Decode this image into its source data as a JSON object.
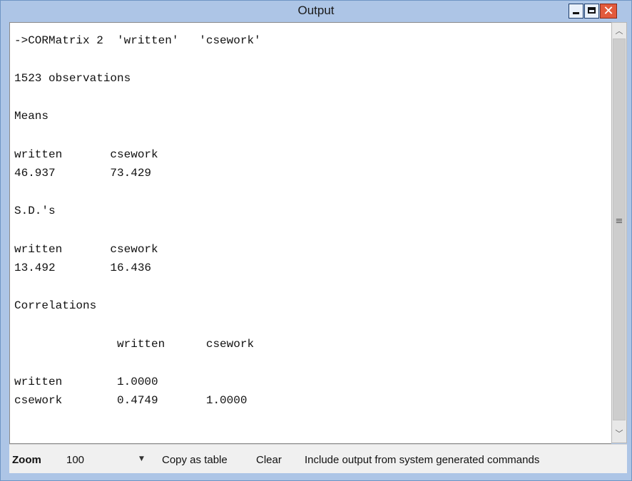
{
  "window": {
    "title": "Output",
    "minimize_glyph": "",
    "maximize_glyph": "",
    "close_glyph": "✕"
  },
  "output": {
    "lines": [
      "->CORMatrix 2  'written'   'csework'",
      "",
      "1523 observations",
      "",
      "Means",
      "",
      "written       csework",
      "46.937        73.429",
      "",
      "S.D.'s",
      "",
      "written       csework",
      "13.492        16.436",
      "",
      "Correlations",
      "",
      "               written      csework",
      "",
      "written        1.0000",
      "csework        0.4749       1.0000"
    ]
  },
  "scrollbar": {
    "up_icon": "chevron-up-icon",
    "down_icon": "chevron-down-icon",
    "up_glyph": "︿",
    "down_glyph": "﹀",
    "grip_glyph": "≡"
  },
  "toolbar": {
    "zoom_label": "Zoom",
    "zoom_value": "100",
    "zoom_arrow": "▼",
    "copy_as_table": "Copy as table",
    "clear": "Clear",
    "include_system": "Include output from system generated commands"
  },
  "colors": {
    "titlebar": "#adc5e6",
    "close_button": "#e25a3c",
    "content_bg": "#ffffff",
    "toolbar_bg": "#f0f0f0"
  }
}
